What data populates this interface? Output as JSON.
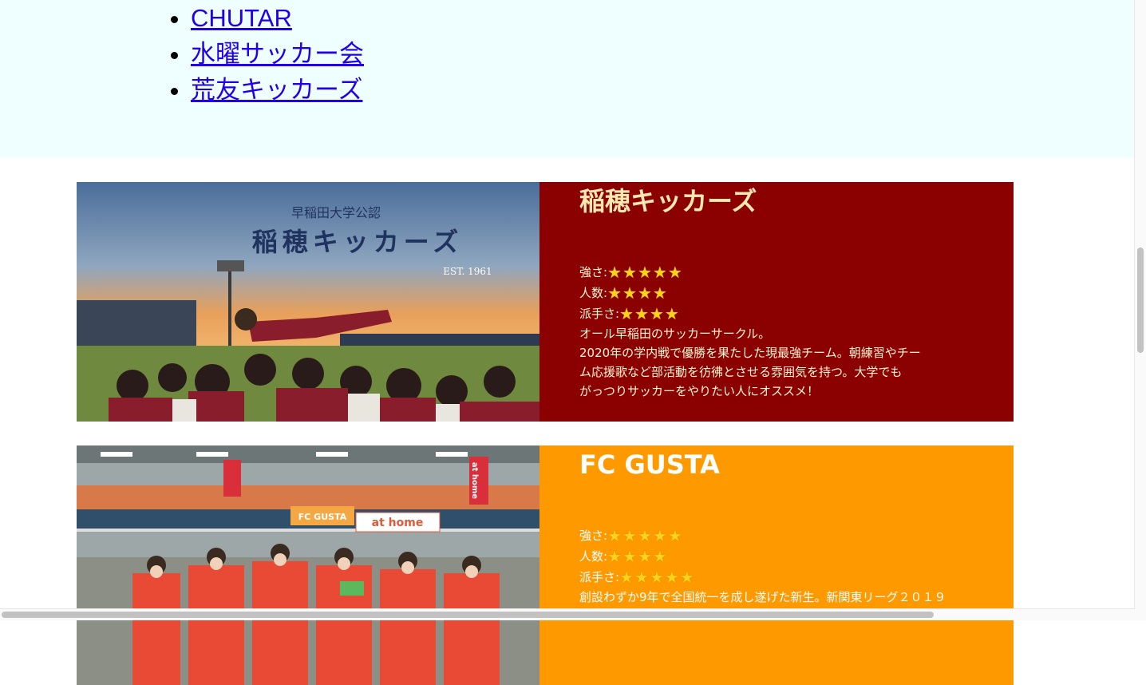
{
  "links": [
    "CHUTAR",
    "水曜サッカー会",
    "荒友キッカーズ"
  ],
  "cards": [
    {
      "name": "稲穂キッカーズ",
      "photo": {
        "official_label": "早稲田大学公認",
        "club_name": "稲穂キッカーズ",
        "est": "EST. 1961"
      },
      "ratings": [
        {
          "label": "強さ:",
          "stars": 5
        },
        {
          "label": "人数:",
          "stars": 4
        },
        {
          "label": "派手さ:",
          "stars": 4
        }
      ],
      "description": "オール早稲田のサッカーサークル。\n2020年の学内戦で優勝を果たした現最強チーム。朝練習やチー\nム応援歌など部活動を彷彿とさせる雰囲気を持つ。大学でも\nがっつりサッカーをやりたい人にオススメ！"
    },
    {
      "name": "FC GUSTA",
      "photo": {
        "banner_1": "at home",
        "banner_2": "FC GUSTA",
        "banner_3": "at home"
      },
      "ratings": [
        {
          "label": "強さ:",
          "stars": 5
        },
        {
          "label": "人数:",
          "stars": 4
        },
        {
          "label": "派手さ:",
          "stars": 5
        }
      ],
      "description": "創設わずか9年で全国統一を成し遂げた新生。新関東リーグ２０１９"
    }
  ],
  "star_glyph": "★",
  "colors": {
    "top_band": "#efffff",
    "card_1": "#8b0000",
    "card_2": "#ff9900",
    "link": "#2200ee"
  }
}
